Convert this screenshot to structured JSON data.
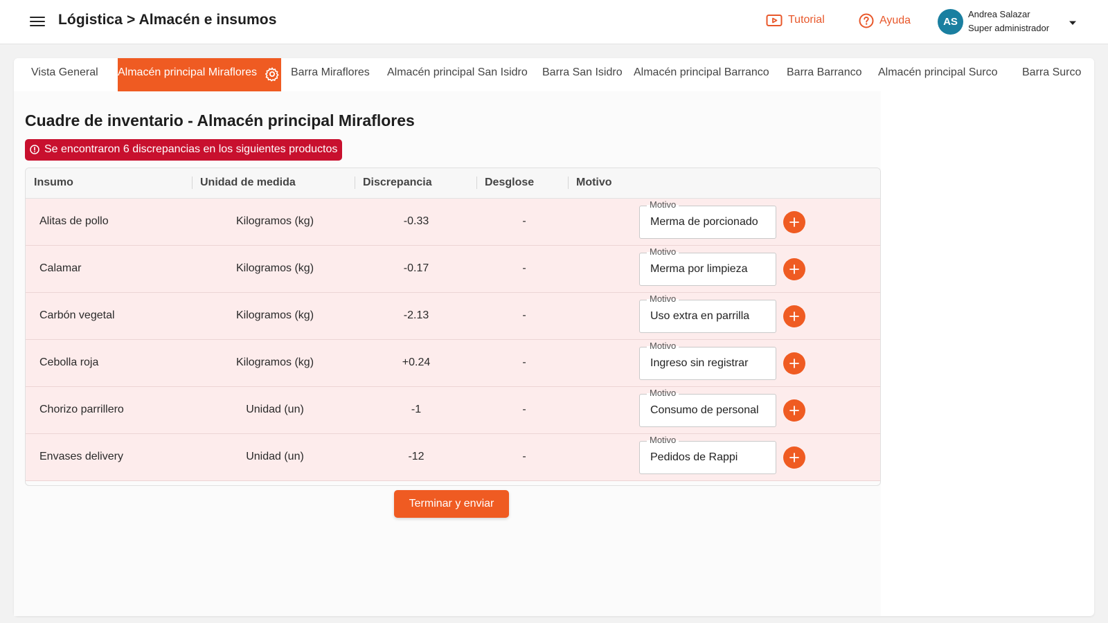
{
  "header": {
    "title": "Lógistica > Almacén e insumos",
    "tutorial_label": "Tutorial",
    "help_label": "Ayuda",
    "user_initials": "AS",
    "user_name": "Andrea Salazar",
    "user_role": "Super administrador"
  },
  "colors": {
    "accent": "#ef5b22",
    "alert": "#c8102e",
    "row_bg": "#fdecec",
    "avatar": "#1a7fa0"
  },
  "tabs": [
    {
      "label": "Vista General",
      "active": false
    },
    {
      "label": "Almacén principal Miraflores",
      "active": true
    },
    {
      "label": "Barra Miraflores",
      "active": false
    },
    {
      "label": "Almacén principal San Isidro",
      "active": false
    },
    {
      "label": "Barra San Isidro",
      "active": false
    },
    {
      "label": "Almacén principal Barranco",
      "active": false
    },
    {
      "label": "Barra Barranco",
      "active": false
    },
    {
      "label": "Almacén principal Surco",
      "active": false
    },
    {
      "label": "Barra Surco",
      "active": false
    }
  ],
  "main": {
    "heading": "Cuadre de inventario - Almacén principal Miraflores",
    "alert_text": "Se encontraron 6 discrepancias en los siguientes productos",
    "submit_label": "Terminar y enviar"
  },
  "table": {
    "columns": [
      "Insumo",
      "Unidad de medida",
      "Discrepancia",
      "Desglose",
      "Motivo"
    ],
    "motivo_field_label": "Motivo",
    "rows": [
      {
        "insumo": "Alitas de pollo",
        "unidad": "Kilogramos (kg)",
        "discrepancia": "-0.33",
        "desglose": "-",
        "motivo": "Merma de porcionado"
      },
      {
        "insumo": "Calamar",
        "unidad": "Kilogramos (kg)",
        "discrepancia": "-0.17",
        "desglose": "-",
        "motivo": "Merma por limpieza"
      },
      {
        "insumo": "Carbón vegetal",
        "unidad": "Kilogramos (kg)",
        "discrepancia": "-2.13",
        "desglose": "-",
        "motivo": "Uso extra en parrilla"
      },
      {
        "insumo": "Cebolla roja",
        "unidad": "Kilogramos (kg)",
        "discrepancia": "+0.24",
        "desglose": "-",
        "motivo": "Ingreso sin registrar"
      },
      {
        "insumo": "Chorizo parrillero",
        "unidad": "Unidad (un)",
        "discrepancia": "-1",
        "desglose": "-",
        "motivo": "Consumo de personal"
      },
      {
        "insumo": "Envases delivery",
        "unidad": "Unidad (un)",
        "discrepancia": "-12",
        "desglose": "-",
        "motivo": "Pedidos de Rappi"
      }
    ]
  }
}
